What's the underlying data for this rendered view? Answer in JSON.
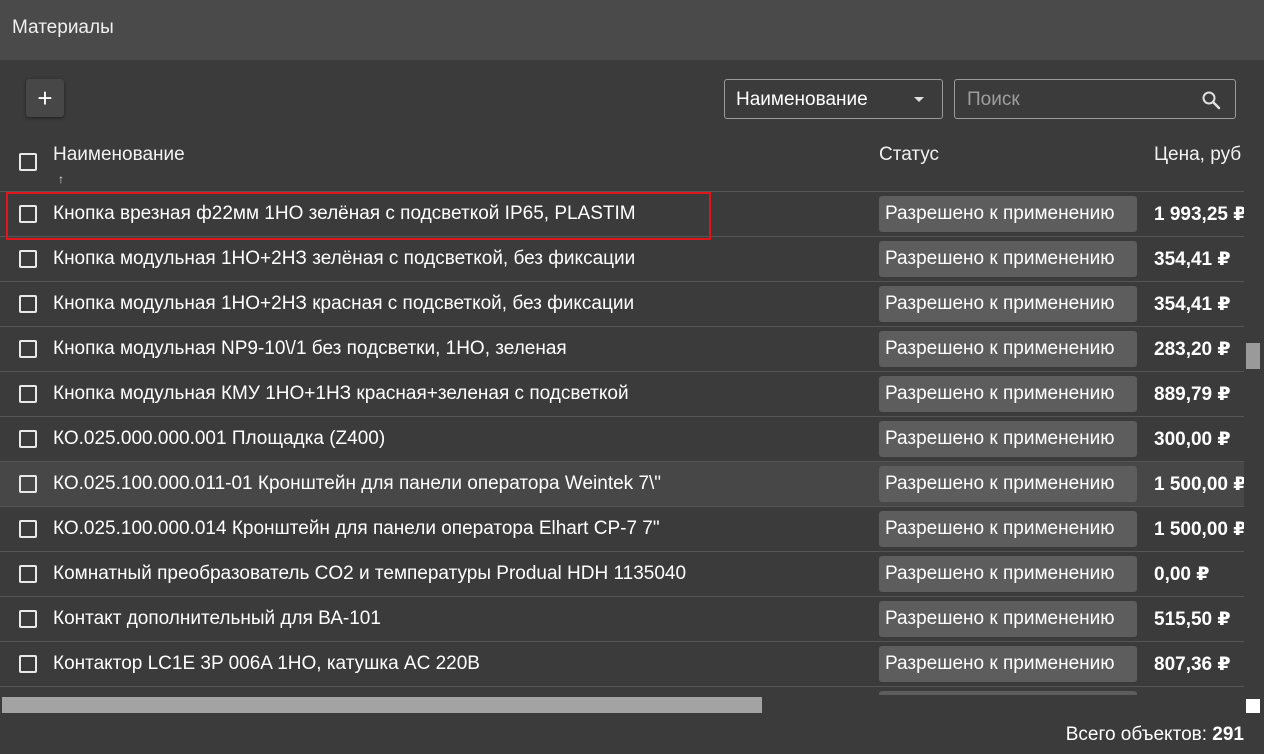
{
  "window": {
    "title": "Материалы"
  },
  "toolbar": {
    "add_label": "+",
    "filter_field": "Наименование",
    "search_placeholder": "Поиск"
  },
  "table": {
    "headers": {
      "name": "Наименование",
      "status": "Статус",
      "price": "Цена, руб"
    },
    "sort_indicator": "↑",
    "rows": [
      {
        "name": "Кнопка врезная ф22мм 1НО зелёная с подсветкой IP65, PLASTIM",
        "status": "Разрешено к применению",
        "price": "1 993,25 ₽"
      },
      {
        "name": "Кнопка модульная 1НО+2НЗ зелёная с подсветкой, без фиксации",
        "status": "Разрешено к применению",
        "price": "354,41 ₽"
      },
      {
        "name": "Кнопка модульная 1НО+2НЗ красная с подсветкой, без фиксации",
        "status": "Разрешено к применению",
        "price": "354,41 ₽"
      },
      {
        "name": "Кнопка модульная NP9-10\\/1 без подсветки, 1НО, зеленая",
        "status": "Разрешено к применению",
        "price": "283,20 ₽"
      },
      {
        "name": "Кнопка модульная КМУ 1НО+1НЗ красная+зеленая с подсветкой",
        "status": "Разрешено к применению",
        "price": "889,79 ₽"
      },
      {
        "name": "КО.025.000.000.001 Площадка (Z400)",
        "status": "Разрешено к применению",
        "price": "300,00 ₽"
      },
      {
        "name": "КО.025.100.000.011-01 Кронштейн для панели оператора Weintek 7\\\"",
        "status": "Разрешено к применению",
        "price": "1 500,00 ₽"
      },
      {
        "name": "КО.025.100.000.014 Кронштейн для панели оператора Elhart CP-7 7\"",
        "status": "Разрешено к применению",
        "price": "1 500,00 ₽"
      },
      {
        "name": "Комнатный преобразователь CO2 и температуры Produal HDH 1135040",
        "status": "Разрешено к применению",
        "price": "0,00 ₽"
      },
      {
        "name": "Контакт дополнительный для ВА-101",
        "status": "Разрешено к применению",
        "price": "515,50 ₽"
      },
      {
        "name": "Контактор LC1E 3P 006A 1НО, катушка AC 220В",
        "status": "Разрешено к применению",
        "price": "807,36 ₽"
      }
    ]
  },
  "footer": {
    "total_label": "Всего объектов:",
    "total_count": "291"
  },
  "colors": {
    "background": "#3b3b3b",
    "titlebar": "#4a4a4a",
    "status_chip": "#5d5d5d",
    "highlight_border": "#e0141b"
  }
}
